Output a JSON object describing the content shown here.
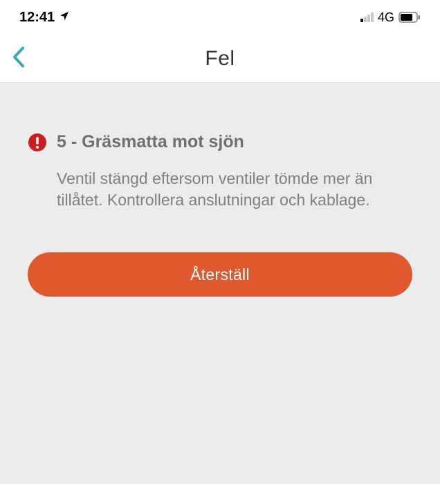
{
  "status_bar": {
    "time": "12:41",
    "location_icon": "location-arrow",
    "signal_active_bars": 1,
    "network_label": "4G",
    "battery_level": 0.78
  },
  "nav": {
    "title": "Fel",
    "back_icon": "chevron-left"
  },
  "error": {
    "icon": "exclamation-circle",
    "heading": "5 - Gräsmatta mot sjön",
    "body": "Ventil stängd eftersom ventiler tömde mer än tillåtet. Kontrollera anslutningar och kablage."
  },
  "actions": {
    "reset_label": "Återställ"
  },
  "colors": {
    "accent": "#e0592e",
    "back_chevron": "#3aa9b5",
    "error_icon": "#c91f1f"
  }
}
